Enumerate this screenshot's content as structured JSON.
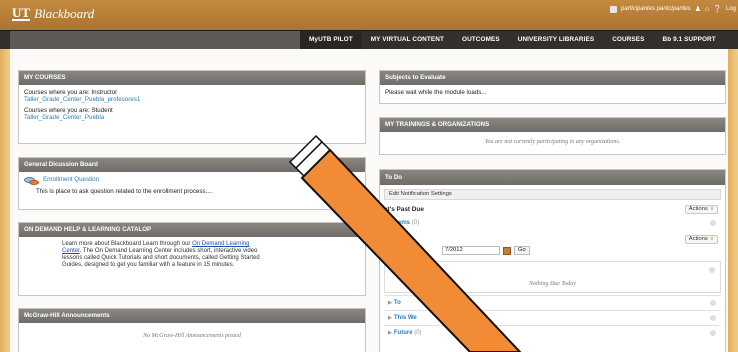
{
  "app": {
    "logo_mark": "UT",
    "logo_text": "Blackboard",
    "username": "participantes participantes",
    "logout_label": "Log"
  },
  "nav": {
    "tabs": [
      {
        "label": "MyUTB PILOT",
        "active": true
      },
      {
        "label": "MY VIRTUAL CONTENT",
        "active": false
      },
      {
        "label": "OUTCOMES",
        "active": false
      },
      {
        "label": "UNIVERSITY LIBRARIES",
        "active": false
      },
      {
        "label": "COURSES",
        "active": false
      },
      {
        "label": "Bb 9.1 SUPPORT",
        "active": false
      }
    ]
  },
  "my_courses": {
    "title": "MY COURSES",
    "instructor_label": "Courses where you are: Instructor",
    "instructor_course": "Taller_Grade_Center_Puebla_profesores1",
    "student_label": "Courses where you are: Student",
    "student_course": "Taller_Grade_Center_Puebla"
  },
  "discussion": {
    "title": "General Dicussion Board",
    "item_title": "Enrollment Question",
    "item_desc": "This is  place to ask question related to the enrollment process...."
  },
  "catalog": {
    "title": "ON DEMAND HELP & LEARNING CATALOP",
    "text_pre": "Learn more about Blackboard Learn through our ",
    "link1": "On Demand Learning Center",
    "text_post": ". The On Demand Learning Center includes short, interactive video lessons called Quick Tutorials and short documents, called Getting Started Guides, designed to get you familiar with a feature in 15 minutes."
  },
  "mcgraw": {
    "title": "McGraw-Hill Announcements",
    "empty": "No McGraw-Hill Announcements posted"
  },
  "subjects": {
    "title": "Subjects to Evaluate",
    "loading": "Please wait while the module loads..."
  },
  "trainings": {
    "title": "MY TRAININGS & ORGANIZATIONS",
    "empty": "You are not currently participating in any organizations."
  },
  "todo": {
    "title": "To Do",
    "edit_settings": "Edit Notification Settings",
    "past_due": "at's Past Due",
    "actions_label": "Actions",
    "all_items_link": "ems",
    "all_items_count": "(0)",
    "date_value": "7/2012",
    "go_label": "Go",
    "nothing_due": "Nothing Due Today",
    "groups": [
      {
        "label": "To",
        "count": ""
      },
      {
        "label": "This We",
        "count": ""
      },
      {
        "label": "Future",
        "count": "(0)"
      }
    ]
  },
  "colors": {
    "header": "#b97e37",
    "overlay_orange": "#f28b36"
  }
}
